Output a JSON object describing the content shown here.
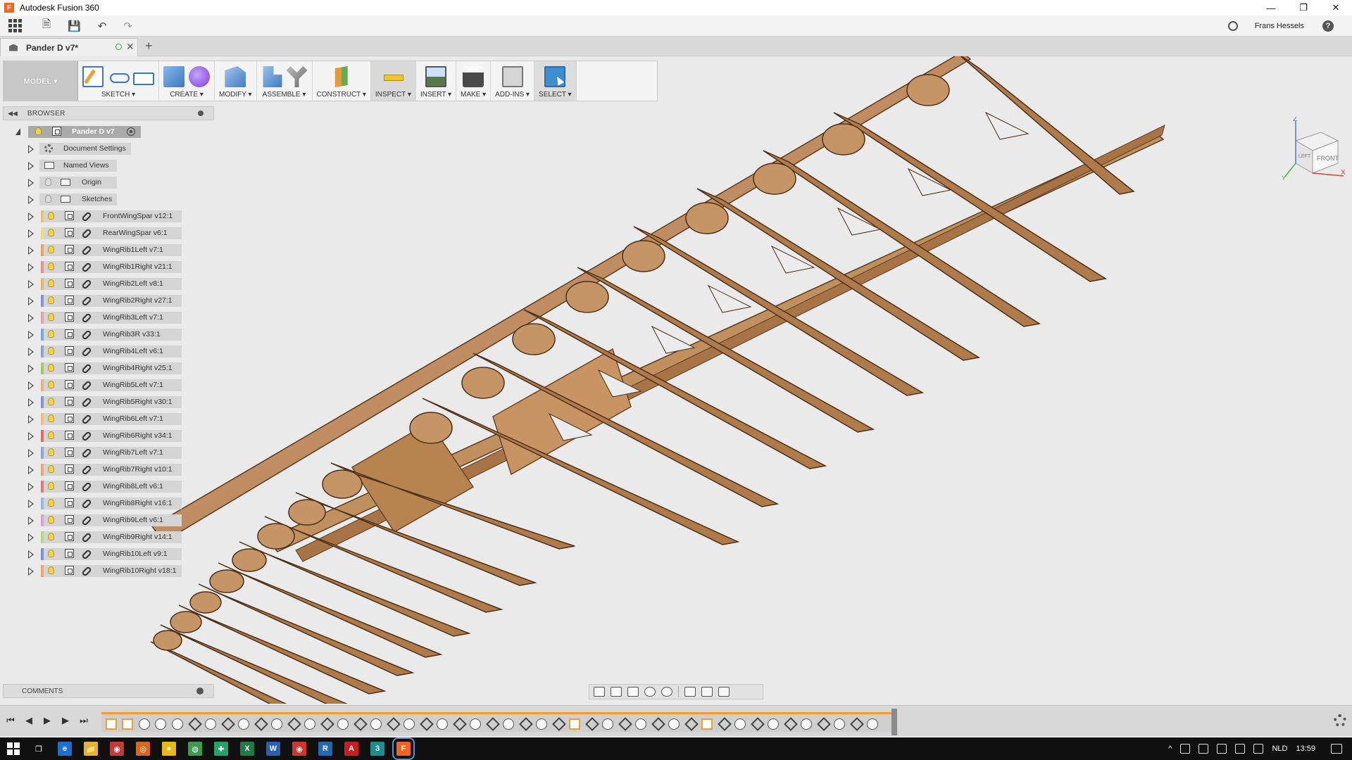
{
  "window": {
    "title": "Autodesk Fusion 360",
    "app_icon_letter": "F",
    "controls": [
      "—",
      "❐",
      "✕"
    ]
  },
  "quick_access": {
    "user_name": "Frans Hessels",
    "help_label": "?",
    "undo_glyph": "↶",
    "redo_glyph": "↷",
    "save_glyph": "💾",
    "file_glyph": "🗎"
  },
  "document_tab": {
    "name": "Pander D v7*",
    "close_glyph": "✕",
    "new_tab_glyph": "+"
  },
  "ribbon": {
    "workspace": "MODEL ▾",
    "groups": [
      {
        "label": "SKETCH ▾",
        "icons": [
          "create-sketch-icon",
          "line-icon",
          "rectangle-icon"
        ]
      },
      {
        "label": "CREATE ▾",
        "icons": [
          "extrude-box-icon",
          "create-form-icon"
        ]
      },
      {
        "label": "MODIFY ▾",
        "icons": [
          "press-pull-icon"
        ]
      },
      {
        "label": "ASSEMBLE ▾",
        "icons": [
          "new-component-icon",
          "joint-icon"
        ]
      },
      {
        "label": "CONSTRUCT ▾",
        "icons": [
          "offset-plane-icon"
        ]
      },
      {
        "label": "INSPECT ▾",
        "icons": [
          "measure-icon"
        ]
      },
      {
        "label": "INSERT ▾",
        "icons": [
          "insert-image-icon"
        ]
      },
      {
        "label": "MAKE ▾",
        "icons": [
          "3d-print-icon"
        ]
      },
      {
        "label": "ADD-INS ▾",
        "icons": [
          "scripts-addins-icon"
        ]
      },
      {
        "label": "SELECT ▾",
        "icons": [
          "select-icon"
        ]
      }
    ]
  },
  "browser": {
    "title": "BROWSER",
    "root": "Pander D v7",
    "nodes": [
      {
        "label": "Document Settings",
        "type": "settings"
      },
      {
        "label": "Named Views",
        "type": "folder"
      },
      {
        "label": "Origin",
        "type": "folder-bulb"
      },
      {
        "label": "Sketches",
        "type": "folder-bulb"
      }
    ],
    "components": [
      {
        "label": "FrontWingSpar v12:1",
        "color": "#e8c56a"
      },
      {
        "label": "RearWingSpar v6:1",
        "color": "#e9e07a"
      },
      {
        "label": "WingRib1Left v7:1",
        "color": "#f2a25a"
      },
      {
        "label": "WingRib1Right v21:1",
        "color": "#e88f8f"
      },
      {
        "label": "WingRib2Left v8:1",
        "color": "#f2b46a"
      },
      {
        "label": "WingRib2Right v27:1",
        "color": "#8a8fe0"
      },
      {
        "label": "WingRib3Left v7:1",
        "color": "#e8a0b8"
      },
      {
        "label": "WingRib3R v33:1",
        "color": "#7aa6e0"
      },
      {
        "label": "WingRib4Left v6:1",
        "color": "#8fa0d8"
      },
      {
        "label": "WingRib4Right v25:1",
        "color": "#a6c86a"
      },
      {
        "label": "WingRib5Left v7:1",
        "color": "#f0b27a"
      },
      {
        "label": "WingRib5Right v30:1",
        "color": "#8a90d8"
      },
      {
        "label": "WingRib6Left v7:1",
        "color": "#f2c070"
      },
      {
        "label": "WingRib6Right v34:1",
        "color": "#e06a6a"
      },
      {
        "label": "WingRib7Left v7:1",
        "color": "#8aa8e0"
      },
      {
        "label": "WingRib7Right v10:1",
        "color": "#f0a86a"
      },
      {
        "label": "WingRib8Left v6:1",
        "color": "#e07a7a"
      },
      {
        "label": "WingRib8Right v16:1",
        "color": "#9ab8e0"
      },
      {
        "label": "WingRib9Left v6:1",
        "color": "#d8a0d8"
      },
      {
        "label": "WingRib9Right v14:1",
        "color": "#b8d880"
      },
      {
        "label": "WingRib10Left v9:1",
        "color": "#7a90e0"
      },
      {
        "label": "WingRib10Right v18:1",
        "color": "#f0a86a"
      }
    ]
  },
  "viewcube": {
    "axis_z": "Z",
    "axis_x": "X",
    "axis_y": "Y",
    "face_front": "FRONT",
    "face_left": "LEFT"
  },
  "comments": {
    "title": "COMMENTS"
  },
  "timeline": {
    "controls": [
      "⏮",
      "◀",
      "▶",
      "▶",
      "⏭"
    ],
    "feature_count": 47
  },
  "taskbar": {
    "apps": [
      {
        "name": "task-view",
        "letter": "❐",
        "color": "#101010"
      },
      {
        "name": "edge",
        "letter": "e",
        "color": "#1e6fd0"
      },
      {
        "name": "explorer",
        "letter": "📁",
        "color": "#e6b33a"
      },
      {
        "name": "app-red",
        "letter": "◉",
        "color": "#c23a3a"
      },
      {
        "name": "app-orange",
        "letter": "◎",
        "color": "#d8661e"
      },
      {
        "name": "app-yellow",
        "letter": "●",
        "color": "#e8b818"
      },
      {
        "name": "chrome",
        "letter": "◍",
        "color": "#3c9b4f"
      },
      {
        "name": "app-green",
        "letter": "✚",
        "color": "#25a36b"
      },
      {
        "name": "excel",
        "letter": "X",
        "color": "#1f7a44"
      },
      {
        "name": "word",
        "letter": "W",
        "color": "#2b5fb0"
      },
      {
        "name": "app-red2",
        "letter": "◉",
        "color": "#d0342c"
      },
      {
        "name": "app-r",
        "letter": "R",
        "color": "#2468b4"
      },
      {
        "name": "acrobat",
        "letter": "A",
        "color": "#c81e1e"
      },
      {
        "name": "app-teal",
        "letter": "3",
        "color": "#1b8e8e"
      },
      {
        "name": "fusion",
        "letter": "F",
        "color": "#f26322"
      }
    ],
    "language": "NLD",
    "time": "13:59",
    "tray_up_glyph": "^"
  }
}
